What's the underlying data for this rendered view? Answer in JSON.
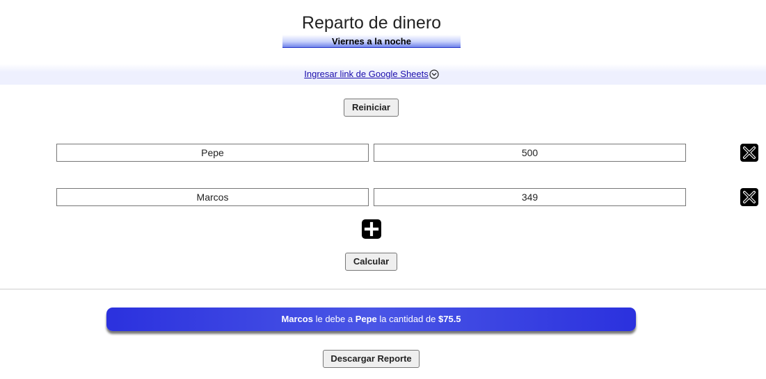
{
  "header": {
    "title": "Reparto de dinero",
    "event_name": "Viernes a la noche"
  },
  "sheets": {
    "link_label": "Ingresar link de Google Sheets",
    "toggle_icon": "chevron-down-circle-icon"
  },
  "actions": {
    "reset_label": "Reiniciar",
    "calculate_label": "Calcular",
    "download_label": "Descargar Reporte",
    "add_icon": "plus-square-icon",
    "delete_icon": "close-x-icon"
  },
  "participants": [
    {
      "name": "Pepe",
      "amount": "500"
    },
    {
      "name": "Marcos",
      "amount": "349"
    }
  ],
  "result": {
    "debtor": "Marcos",
    "text_owes": "le debe a",
    "creditor": "Pepe",
    "text_amount": "la cantidad de",
    "amount": "$75.5"
  },
  "colors": {
    "result_bg": "#2b31de",
    "link": "#1a0dab",
    "sheets_bar": "#eef0fe"
  }
}
